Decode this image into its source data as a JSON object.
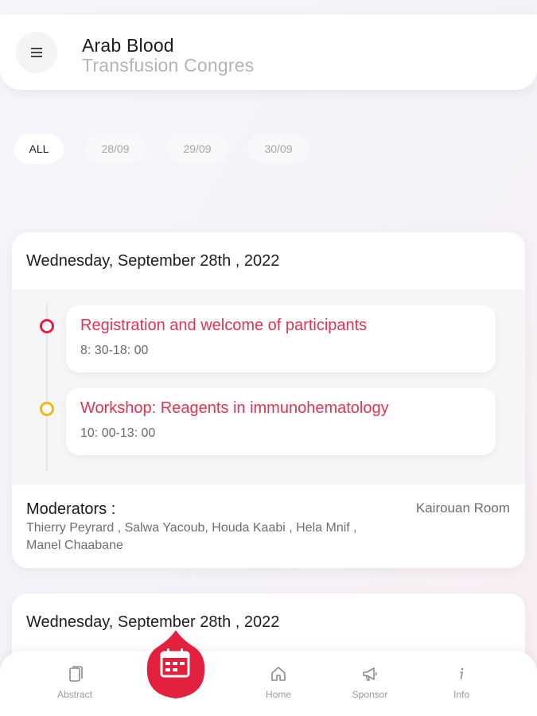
{
  "header": {
    "title_line1": "Arab Blood",
    "title_line2": "Transfusion Congres",
    "menu_icon": "hamburger-icon"
  },
  "tabs": [
    {
      "label": "ALL",
      "active": true
    },
    {
      "label": "28/09",
      "active": false
    },
    {
      "label": "29/09",
      "active": false
    },
    {
      "label": "30/09",
      "active": false
    }
  ],
  "cards": [
    {
      "date": "Wednesday, September 28th , 2022",
      "sessions": [
        {
          "title": "Registration and welcome of participants",
          "time": "8: 30-18: 00",
          "status_color": "#e3213f"
        },
        {
          "title": "Workshop: Reagents in immunohematology",
          "time": "10: 00-13: 00",
          "status_color": "#f3b51d"
        }
      ],
      "moderators_label": "Moderators :",
      "moderators": "Thierry Peyrard , Salwa Yacoub, Houda Kaabi , Hela Mnif , Manel Chaabane",
      "room": "Kairouan Room"
    },
    {
      "date": "Wednesday, September 28th , 2022"
    }
  ],
  "bottom_nav": {
    "items": [
      {
        "label": "Abstract",
        "icon": "document-icon"
      },
      {
        "label": "Home",
        "icon": "home-icon"
      },
      {
        "label": "Sponsor",
        "icon": "megaphone-icon"
      },
      {
        "label": "Info",
        "icon": "info-icon"
      }
    ],
    "center_button_icon": "calendar-icon"
  },
  "colors": {
    "accent": "#e3213f",
    "session_title": "#e5324f",
    "pending": "#f3b51d"
  }
}
